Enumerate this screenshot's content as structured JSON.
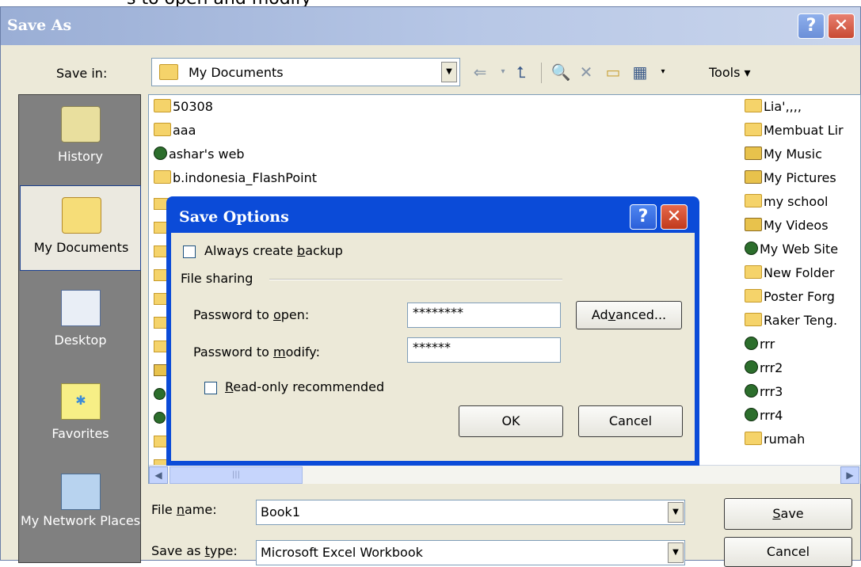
{
  "top_text": "s to open and modify",
  "dialog": {
    "title": "Save As",
    "help_symbol": "?",
    "close_symbol": "✕",
    "save_in_label": "Save in:",
    "save_in_value": "My Documents",
    "tools_label": "Tools ▾"
  },
  "places": [
    {
      "label": "History",
      "icon": "history-icon"
    },
    {
      "label": "My Documents",
      "icon": "my-documents-icon"
    },
    {
      "label": "Desktop",
      "icon": "desktop-icon"
    },
    {
      "label": "Favorites",
      "icon": "favorites-icon"
    },
    {
      "label": "My Network Places",
      "icon": "network-places-icon"
    }
  ],
  "files_left": [
    {
      "name": "50308",
      "type": "folder"
    },
    {
      "name": "aaa",
      "type": "folder"
    },
    {
      "name": "ashar's web",
      "type": "web"
    },
    {
      "name": "b.indonesia_FlashPoint",
      "type": "folder"
    }
  ],
  "files_right": [
    {
      "name": "Lia',,,,",
      "type": "folder"
    },
    {
      "name": "Membuat Lir",
      "type": "folder"
    },
    {
      "name": "My Music",
      "type": "special"
    },
    {
      "name": "My Pictures",
      "type": "special"
    },
    {
      "name": "my school",
      "type": "folder"
    },
    {
      "name": "My Videos",
      "type": "special"
    },
    {
      "name": "My Web Site",
      "type": "web"
    },
    {
      "name": "New Folder",
      "type": "folder"
    },
    {
      "name": "Poster Forg",
      "type": "folder"
    },
    {
      "name": "Raker Teng.",
      "type": "folder"
    },
    {
      "name": "rrr",
      "type": "web"
    },
    {
      "name": "rrr2",
      "type": "web"
    },
    {
      "name": "rrr3",
      "type": "web"
    },
    {
      "name": "rrr4",
      "type": "web"
    },
    {
      "name": "rumah",
      "type": "folder"
    }
  ],
  "file_name": {
    "label_pre": "File ",
    "label_key": "n",
    "label_post": "ame:",
    "value": "Book1"
  },
  "file_type": {
    "label_pre": "Save as ",
    "label_key": "t",
    "label_post": "ype:",
    "value": "Microsoft Excel Workbook"
  },
  "buttons": {
    "save_key": "S",
    "save_rest": "ave",
    "cancel": "Cancel"
  },
  "save_options": {
    "title": "Save Options",
    "backup_pre": "Always create ",
    "backup_key": "b",
    "backup_post": "ackup",
    "backup_checked": false,
    "file_sharing": "File sharing",
    "pw_open_pre": "Password to ",
    "pw_open_key": "o",
    "pw_open_post": "pen:",
    "pw_open_value": "********",
    "advanced_pre": "Ad",
    "advanced_key": "v",
    "advanced_post": "anced...",
    "pw_modify_pre": "Password to ",
    "pw_modify_key": "m",
    "pw_modify_post": "odify:",
    "pw_modify_value": "******",
    "readonly_key": "R",
    "readonly_post": "ead-only recommended",
    "readonly_checked": false,
    "ok": "OK",
    "cancel": "Cancel"
  },
  "colors": {
    "accent": "#0b4bd8",
    "dialog_bg": "#ece9d8"
  }
}
